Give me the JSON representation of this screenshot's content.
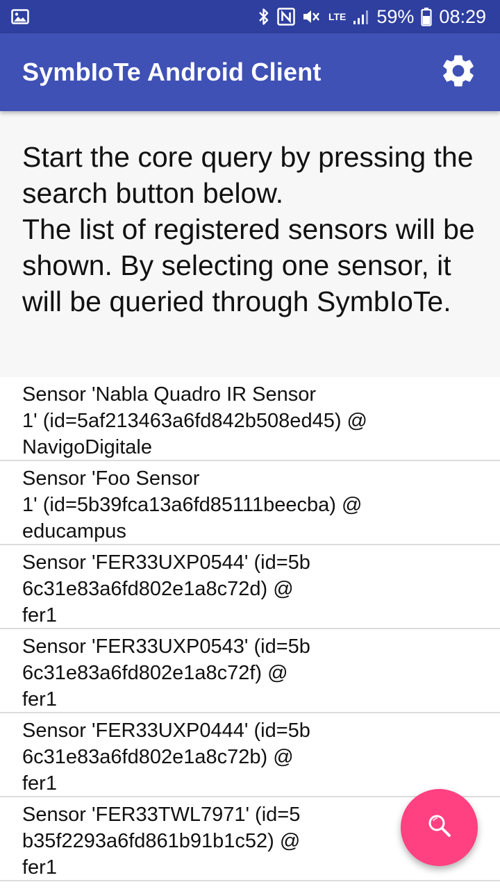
{
  "status_bar": {
    "battery": "59%",
    "time": "08:29",
    "network": "LTE",
    "icons": [
      "image-icon",
      "bluetooth-icon",
      "nfc-icon",
      "mute-icon",
      "lte-icon",
      "signal-icon",
      "battery-icon"
    ]
  },
  "app_bar": {
    "title": "SymbIoTe Android Client",
    "settings_icon": "gear-icon"
  },
  "intro": {
    "text": "Start the core query by pressing the search button below.\nThe list of registered sensors will be shown. By selecting one sensor, it will be queried through SymbIoTe."
  },
  "sensors": [
    {
      "text": "Sensor 'Nabla Quadro IR Sensor\n1' (id=5af213463a6fd842b508ed45) @\nNavigoDigitale"
    },
    {
      "text": "Sensor 'Foo Sensor\n1' (id=5b39fca13a6fd85111beecba) @\neducampus"
    },
    {
      "text": "Sensor 'FER33UXP0544' (id=5b\n6c31e83a6fd802e1a8c72d) @\nfer1"
    },
    {
      "text": "Sensor 'FER33UXP0543' (id=5b\n6c31e83a6fd802e1a8c72f) @\nfer1"
    },
    {
      "text": "Sensor 'FER33UXP0444' (id=5b\n6c31e83a6fd802e1a8c72b) @\nfer1"
    },
    {
      "text": "Sensor 'FER33TWL7971' (id=5\nb35f2293a6fd861b91b1c52) @\nfer1"
    }
  ],
  "fab": {
    "icon": "search-icon"
  },
  "colors": {
    "status_bar": "#2f3f9f",
    "primary": "#3f51b5",
    "accent": "#ff4081"
  }
}
